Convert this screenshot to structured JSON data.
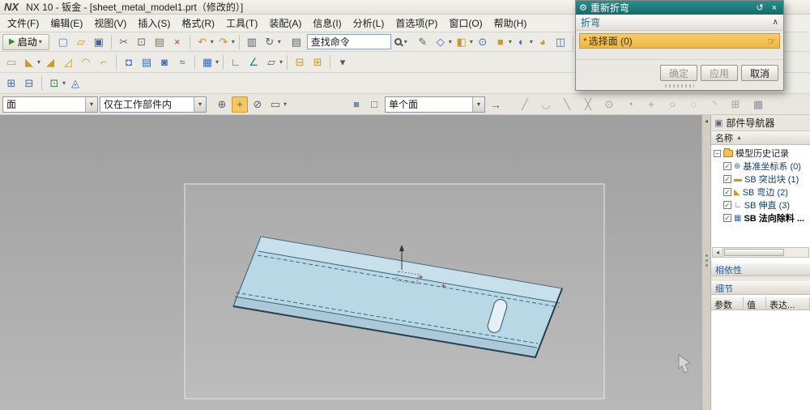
{
  "colors": {
    "dialog_header_teal": "#1b7a7a",
    "selection_highlight_orange": "#f0bf4a",
    "part_fill_blue": "#b9d8e6",
    "panel_header_blue": "#2456a0"
  },
  "window": {
    "logo": "NX",
    "title": "NX 10 - 钣金 - [sheet_metal_model1.prt（修改的）]"
  },
  "menus": [
    {
      "name": "menu-file",
      "label": "文件(F)"
    },
    {
      "name": "menu-edit",
      "label": "编辑(E)"
    },
    {
      "name": "menu-view",
      "label": "视图(V)"
    },
    {
      "name": "menu-insert",
      "label": "插入(S)"
    },
    {
      "name": "menu-format",
      "label": "格式(R)"
    },
    {
      "name": "menu-tools",
      "label": "工具(T)"
    },
    {
      "name": "menu-assemblies",
      "label": "装配(A)"
    },
    {
      "name": "menu-information",
      "label": "信息(I)"
    },
    {
      "name": "menu-analysis",
      "label": "分析(L)"
    },
    {
      "name": "menu-preferences",
      "label": "首选项(P)"
    },
    {
      "name": "menu-window",
      "label": "窗口(O)"
    },
    {
      "name": "menu-help",
      "label": "帮助(H)"
    }
  ],
  "toolbar1": {
    "start_label": "启动",
    "search_value": "查找命令",
    "left_icons": [
      {
        "n": "new-part-icon",
        "g": "▢",
        "c": "#5b7fc4"
      },
      {
        "n": "open-icon",
        "g": "▱",
        "c": "#c99a27"
      },
      {
        "n": "save-icon",
        "g": "▣",
        "c": "#41639e"
      },
      {
        "sep": true
      },
      {
        "n": "cut-icon",
        "g": "✂",
        "c": "#6b6b6b"
      },
      {
        "n": "copy-icon",
        "g": "⊡",
        "c": "#6b6b6b"
      },
      {
        "n": "paste-icon",
        "g": "▤",
        "c": "#8a7340"
      },
      {
        "n": "delete-icon",
        "g": "×",
        "c": "#c23b2e"
      },
      {
        "sep": true
      },
      {
        "n": "undo-icon",
        "g": "↶",
        "c": "#d98a1f",
        "dd": true
      },
      {
        "n": "redo-icon",
        "g": "↷",
        "c": "#d98a1f",
        "dd": true
      },
      {
        "sep": true
      },
      {
        "n": "print-icon",
        "g": "▥",
        "c": "#556070"
      },
      {
        "n": "repeat-command-icon",
        "g": "↻",
        "c": "#556070",
        "dd": true
      }
    ],
    "right_icons": [
      {
        "n": "sketch-icon",
        "g": "✎",
        "c": "#3a7a3a"
      },
      {
        "n": "datum-plane-icon",
        "g": "◇",
        "c": "#3a6ab8",
        "dd": true
      },
      {
        "n": "extrude-icon",
        "g": "◧",
        "c": "#c99a27",
        "dd": true
      },
      {
        "n": "hole-icon",
        "g": "⊙",
        "c": "#3a6ab8"
      },
      {
        "n": "block-icon",
        "g": "■",
        "c": "#c99a27",
        "dd": true
      },
      {
        "n": "unite-icon",
        "g": "◐",
        "c": "#3a6ab8",
        "dd": true
      },
      {
        "n": "edge-blend-icon",
        "g": "◕",
        "c": "#c99a27"
      },
      {
        "n": "shell-icon",
        "g": "◫",
        "c": "#3a6ab8"
      },
      {
        "sep": true
      },
      {
        "n": "view-orient-icon",
        "g": "◩",
        "c": "#666e78",
        "dd": true
      },
      {
        "n": "render-style-icon",
        "g": "◪",
        "c": "#666e78",
        "dd": true
      },
      {
        "n": "show-hide-icon",
        "g": "△",
        "c": "#666e78"
      }
    ]
  },
  "toolbar2": {
    "icons": [
      {
        "n": "tab-command-icon",
        "g": "▭",
        "c": "#c99a27"
      },
      {
        "n": "flange-command-icon",
        "g": "◣",
        "c": "#c99a27",
        "dd": true
      },
      {
        "n": "contour-flange-icon",
        "g": "◢",
        "c": "#c99a27"
      },
      {
        "n": "lofted-flange-icon",
        "g": "◿",
        "c": "#c99a27"
      },
      {
        "n": "hem-flange-icon",
        "g": "◠",
        "c": "#c99a27"
      },
      {
        "n": "jog-icon",
        "g": "⌐",
        "c": "#c99a27"
      },
      {
        "sep": true
      },
      {
        "n": "dimple-icon",
        "g": "◘",
        "c": "#3a6ab8"
      },
      {
        "n": "louver-icon",
        "g": "▤",
        "c": "#3a6ab8"
      },
      {
        "n": "drawn-cutout-icon",
        "g": "◙",
        "c": "#3a6ab8"
      },
      {
        "n": "bead-icon",
        "g": "≈",
        "c": "#3a6ab8"
      },
      {
        "sep": true
      },
      {
        "n": "normal-cutout-icon",
        "g": "▦",
        "c": "#3a6ab8",
        "dd": true
      },
      {
        "sep": true
      },
      {
        "n": "unbend-icon",
        "g": "∟",
        "c": "#2a7a8a"
      },
      {
        "n": "rebend-icon",
        "g": "∠",
        "c": "#2a7a8a"
      },
      {
        "n": "flat-pattern-icon",
        "g": "▱",
        "c": "#2a7a8a",
        "dd": true
      },
      {
        "sep": true
      },
      {
        "n": "convert-to-sheetmetal-icon",
        "g": "⊟",
        "c": "#c99a27"
      },
      {
        "n": "sheetmetal-from-solid-icon",
        "g": "⊞",
        "c": "#c99a27"
      },
      {
        "sep": true
      },
      {
        "n": "more-commands-icon",
        "g": "▾",
        "c": "#555555"
      }
    ]
  },
  "toolbar3": {
    "icons": [
      {
        "n": "pattern-feature-icon",
        "g": "⊞",
        "c": "#3a6ab8"
      },
      {
        "n": "mirror-feature-icon",
        "g": "⊟",
        "c": "#3a6ab8"
      },
      {
        "sep": true
      },
      {
        "n": "expression-icon",
        "g": "⊡",
        "c": "#3a7a3a",
        "dd": true
      },
      {
        "n": "measure-distance-icon",
        "g": "◬",
        "c": "#3a6ab8"
      }
    ]
  },
  "selection_bar": {
    "type_filter": "面",
    "scope_filter": "仅在工作部件内",
    "face_rule": "单个面",
    "mid_icons": [
      {
        "n": "select-all-icon",
        "g": "⊕",
        "c": "#556070"
      },
      {
        "n": "snap-point-toggle-icon",
        "g": "+",
        "c": "#556070",
        "hl": true
      },
      {
        "n": "deselect-all-icon",
        "g": "⊘",
        "c": "#556070"
      },
      {
        "n": "lasso-select-icon",
        "g": "▭",
        "c": "#556070",
        "dd": true
      }
    ],
    "view_icons": [
      {
        "n": "shaded-cube-icon",
        "g": "■",
        "c": "#7a8ea4"
      },
      {
        "n": "wireframe-cube-icon",
        "g": "□",
        "c": "#556070"
      }
    ],
    "snap_icons": [
      {
        "n": "endpoint-snap-icon",
        "g": "╱",
        "c": "#9aa0a6"
      },
      {
        "n": "midpoint-snap-icon",
        "g": "◡",
        "c": "#9aa0a6"
      },
      {
        "n": "control-point-snap-icon",
        "g": "╲",
        "c": "#9aa0a6"
      },
      {
        "n": "intersection-snap-icon",
        "g": "╳",
        "c": "#9aa0a6"
      },
      {
        "n": "arc-center-snap-icon",
        "g": "⊙",
        "c": "#9aa0a6"
      },
      {
        "n": "quadrant-snap-icon",
        "g": "◔",
        "c": "#9aa0a6"
      },
      {
        "n": "existing-point-snap-icon",
        "g": "+",
        "c": "#9aa0a6"
      },
      {
        "n": "point-on-curve-snap-icon",
        "g": "○",
        "c": "#9aa0a6"
      },
      {
        "n": "point-on-surface-snap-icon",
        "g": "◌",
        "c": "#9aa0a6"
      },
      {
        "n": "tangent-snap-icon",
        "g": "◝",
        "c": "#9aa0a6"
      },
      {
        "n": "face-center-snap-icon",
        "g": "⊞",
        "c": "#9aa0a6"
      }
    ],
    "grid_icon": {
      "n": "grid-snap-icon",
      "g": "▦",
      "c": "#8a8f96"
    }
  },
  "dialog": {
    "title": "重新折弯",
    "section": "折弯",
    "required_mark": "*",
    "select_face": "选择面 (0)",
    "ok": "确定",
    "apply": "应用",
    "cancel": "取消"
  },
  "navigator": {
    "title": "部件导航器",
    "name_column": "名称",
    "history_root": "模型历史记录",
    "items": [
      {
        "name": "feature-datum-csys",
        "label": "基准坐标系 (0)",
        "icon_glyph": "⊕",
        "icon_color": "#3a6ab8",
        "bold": false
      },
      {
        "name": "feature-sb-tab",
        "label": "SB 突出块 (1)",
        "icon_glyph": "▬",
        "icon_color": "#c99a27",
        "bold": false
      },
      {
        "name": "feature-sb-flange",
        "label": "SB 弯边 (2)",
        "icon_glyph": "◣",
        "icon_color": "#c99a27",
        "bold": false
      },
      {
        "name": "feature-sb-unbend",
        "label": "SB 伸直 (3)",
        "icon_glyph": "∟",
        "icon_color": "#2a7a8a",
        "bold": false
      },
      {
        "name": "feature-sb-normal-cutout",
        "label": "SB 法向除料 ...",
        "icon_glyph": "▦",
        "icon_color": "#3a6ab8",
        "bold": true
      }
    ],
    "dependencies": "相依性",
    "details": "细节",
    "details_columns": [
      "参数",
      "值",
      "表达..."
    ]
  }
}
